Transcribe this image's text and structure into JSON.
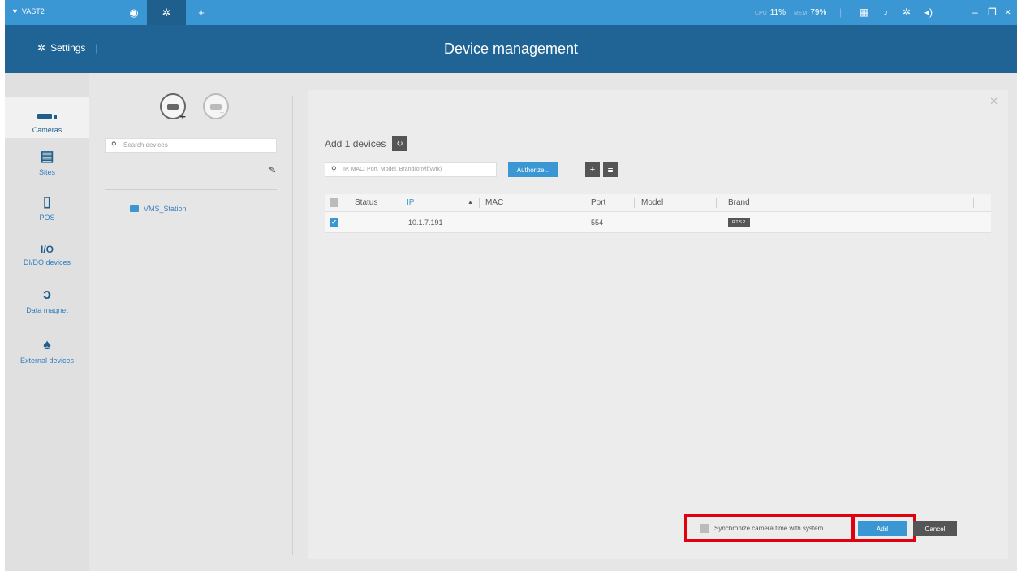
{
  "titlebar": {
    "app_name": "VAST2",
    "tabs": [
      {
        "icon": "liveview-icon"
      },
      {
        "icon": "settings-icon",
        "active": true
      },
      {
        "icon": "plus-icon"
      }
    ],
    "cpu_label": "CPU",
    "cpu_value": "11%",
    "mem_label": "MEM",
    "mem_value": "79%",
    "icons": [
      "grid-icon",
      "bell-icon",
      "gear-icon",
      "volume-icon",
      "minimize-icon",
      "restore-icon",
      "close-icon"
    ]
  },
  "header": {
    "section": "Settings",
    "title": "Device management"
  },
  "nav": {
    "items": [
      {
        "label": "Cameras",
        "icon": "camera-icon",
        "active": true
      },
      {
        "label": "Sites",
        "icon": "server-icon"
      },
      {
        "label": "POS",
        "icon": "pos-icon"
      },
      {
        "label": "DI/DO devices",
        "icon": "io-icon",
        "glyph": "I/O"
      },
      {
        "label": "Data magnet",
        "icon": "magnet-icon"
      },
      {
        "label": "External devices",
        "icon": "joystick-icon"
      }
    ]
  },
  "tree": {
    "search_placeholder": "Search devices",
    "node": "VMS_Station"
  },
  "dialog": {
    "add_title": "Add 1 devices",
    "filter_placeholder": "IP, MAC, Port, Model, Brand(onvif/vvtk)",
    "authorize_label": "Authorize...",
    "columns": [
      "Status",
      "IP",
      "MAC",
      "Port",
      "Model",
      "Brand"
    ],
    "rows": [
      {
        "checked": true,
        "status": "",
        "ip": "10.1.7.191",
        "mac": "",
        "port": "554",
        "model": "",
        "brand": "RTSP"
      }
    ],
    "sync_label": "Synchronize camera time with system",
    "add_label": "Add",
    "cancel_label": "Cancel"
  },
  "colors": {
    "titlebar": "#3b97d3",
    "header": "#1f6494",
    "accent": "#3b97d3",
    "highlight": "#e0000e"
  }
}
